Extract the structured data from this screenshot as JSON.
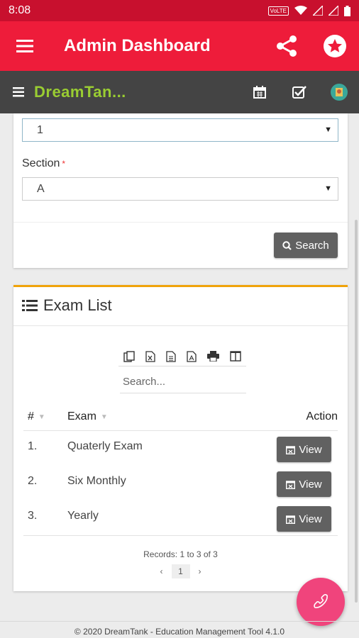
{
  "status_bar": {
    "time": "8:08",
    "volte": "VoLTE"
  },
  "app_bar": {
    "title": "Admin Dashboard"
  },
  "sub_bar": {
    "brand": "DreamTan..."
  },
  "filter": {
    "class_value": "1",
    "section_label": "Section",
    "section_required": "*",
    "section_value": "A",
    "search_button": "Search"
  },
  "exam_list": {
    "title": "Exam List",
    "search_placeholder": "Search...",
    "columns": {
      "num": "#",
      "exam": "Exam",
      "action": "Action"
    },
    "rows": [
      {
        "num": "1.",
        "exam": "Quaterly Exam",
        "action": "View"
      },
      {
        "num": "2.",
        "exam": "Six Monthly",
        "action": "View"
      },
      {
        "num": "3.",
        "exam": "Yearly",
        "action": "View"
      }
    ],
    "records": "Records: 1 to 3 of 3",
    "pager": {
      "prev": "‹",
      "current": "1",
      "next": "›"
    }
  },
  "footer": {
    "text": "© 2020 DreamTank - Education Management Tool 4.1.0"
  },
  "colors": {
    "status_bar": "#c8102e",
    "app_bar": "#ee1c3a",
    "sub_bar": "#444444",
    "brand": "#9acd32",
    "accent_border": "#f0a30a",
    "fab": "#f0447c",
    "button": "#616161"
  },
  "icons": [
    "menu-icon",
    "share-icon",
    "star-icon",
    "calendar-icon",
    "checkbox-icon",
    "avatar-icon",
    "search-icon",
    "list-icon",
    "copy-icon",
    "excel-icon",
    "csv-icon",
    "pdf-icon",
    "print-icon",
    "columns-icon",
    "calendar-view-icon",
    "phone-icon"
  ]
}
